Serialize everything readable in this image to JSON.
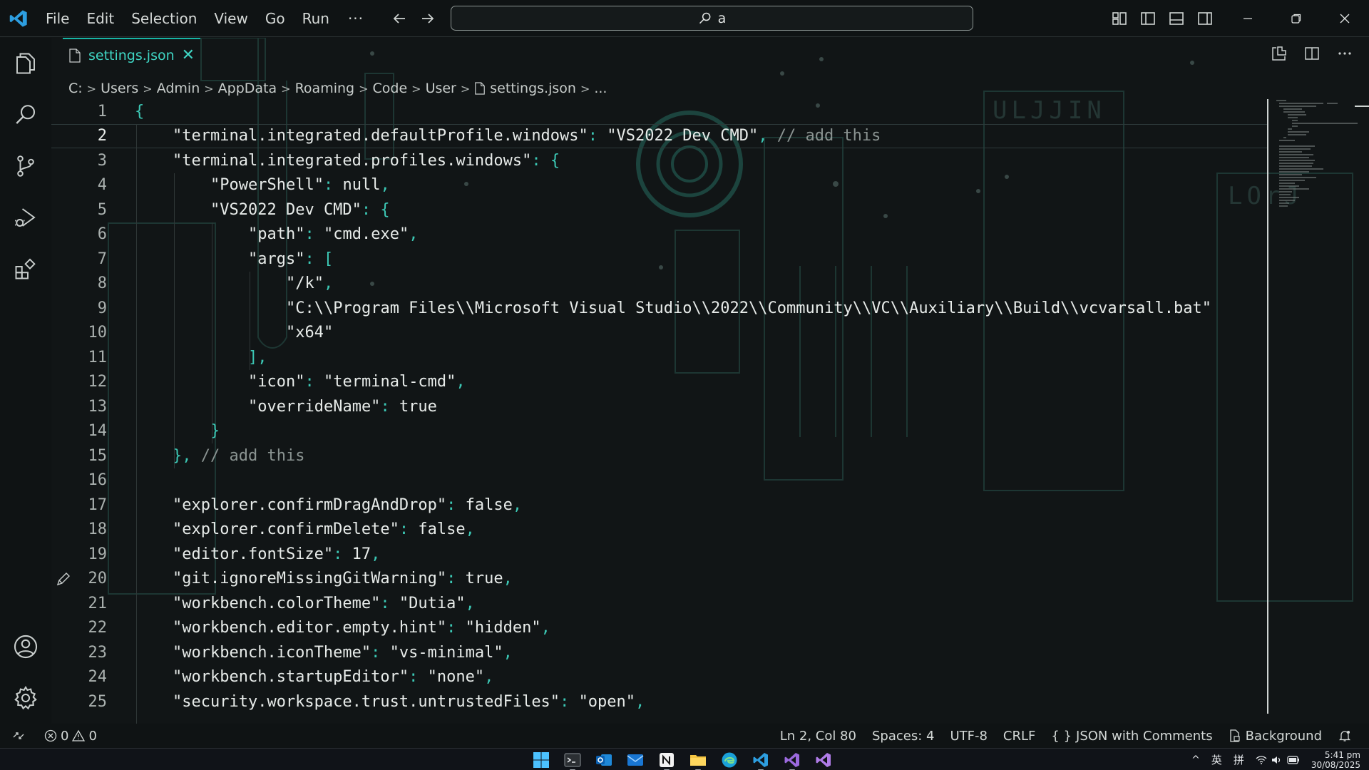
{
  "menu": {
    "items": [
      "File",
      "Edit",
      "Selection",
      "View",
      "Go",
      "Run"
    ],
    "more": "···"
  },
  "command_center": {
    "text": "a"
  },
  "colors": {
    "accent": "#18b6a5",
    "punct": "#3cc8b5",
    "comment": "#8a9391",
    "background": "#111516"
  },
  "tab": {
    "label": "settings.json",
    "close": "✕"
  },
  "breadcrumb": {
    "items": [
      "C:",
      "Users",
      "Admin",
      "AppData",
      "Roaming",
      "Code",
      "User",
      "settings.json",
      "..."
    ]
  },
  "editor": {
    "current_line": 2,
    "lines": [
      {
        "n": "1",
        "indent": 0,
        "tokens": [
          [
            "p",
            "{"
          ]
        ]
      },
      {
        "n": "2",
        "indent": 1,
        "tokens": [
          [
            "k",
            "\"terminal.integrated.defaultProfile.windows\""
          ],
          [
            "p",
            ": "
          ],
          [
            "k",
            "\"VS2022 Dev CMD\""
          ],
          [
            "p",
            ", "
          ],
          [
            "c",
            "// add this"
          ]
        ]
      },
      {
        "n": "3",
        "indent": 1,
        "tokens": [
          [
            "k",
            "\"terminal.integrated.profiles.windows\""
          ],
          [
            "p",
            ": {"
          ]
        ]
      },
      {
        "n": "4",
        "indent": 2,
        "tokens": [
          [
            "k",
            "\"PowerShell\""
          ],
          [
            "p",
            ": "
          ],
          [
            "k",
            "null"
          ],
          [
            "p",
            ","
          ]
        ]
      },
      {
        "n": "5",
        "indent": 2,
        "tokens": [
          [
            "k",
            "\"VS2022 Dev CMD\""
          ],
          [
            "p",
            ": {"
          ]
        ]
      },
      {
        "n": "6",
        "indent": 3,
        "tokens": [
          [
            "k",
            "\"path\""
          ],
          [
            "p",
            ": "
          ],
          [
            "k",
            "\"cmd.exe\""
          ],
          [
            "p",
            ","
          ]
        ]
      },
      {
        "n": "7",
        "indent": 3,
        "tokens": [
          [
            "k",
            "\"args\""
          ],
          [
            "p",
            ": ["
          ]
        ]
      },
      {
        "n": "8",
        "indent": 4,
        "tokens": [
          [
            "k",
            "\"/k\""
          ],
          [
            "p",
            ","
          ]
        ]
      },
      {
        "n": "9",
        "indent": 4,
        "tokens": [
          [
            "k",
            "\"C:\\\\Program Files\\\\Microsoft Visual Studio\\\\2022\\\\Community\\\\VC\\\\Auxiliary\\\\Build\\\\vcvarsall.bat\""
          ]
        ]
      },
      {
        "n": "10",
        "indent": 4,
        "tokens": [
          [
            "k",
            "\"x64\""
          ]
        ]
      },
      {
        "n": "11",
        "indent": 3,
        "tokens": [
          [
            "p",
            "],"
          ]
        ]
      },
      {
        "n": "12",
        "indent": 3,
        "tokens": [
          [
            "k",
            "\"icon\""
          ],
          [
            "p",
            ": "
          ],
          [
            "k",
            "\"terminal-cmd\""
          ],
          [
            "p",
            ","
          ]
        ]
      },
      {
        "n": "13",
        "indent": 3,
        "tokens": [
          [
            "k",
            "\"overrideName\""
          ],
          [
            "p",
            ": "
          ],
          [
            "k",
            "true"
          ]
        ]
      },
      {
        "n": "14",
        "indent": 2,
        "tokens": [
          [
            "p",
            "}"
          ]
        ]
      },
      {
        "n": "15",
        "indent": 1,
        "tokens": [
          [
            "p",
            "}, "
          ],
          [
            "c",
            "// add this"
          ]
        ]
      },
      {
        "n": "16",
        "indent": 0,
        "tokens": []
      },
      {
        "n": "17",
        "indent": 1,
        "tokens": [
          [
            "k",
            "\"explorer.confirmDragAndDrop\""
          ],
          [
            "p",
            ": "
          ],
          [
            "k",
            "false"
          ],
          [
            "p",
            ","
          ]
        ]
      },
      {
        "n": "18",
        "indent": 1,
        "tokens": [
          [
            "k",
            "\"explorer.confirmDelete\""
          ],
          [
            "p",
            ": "
          ],
          [
            "k",
            "false"
          ],
          [
            "p",
            ","
          ]
        ]
      },
      {
        "n": "19",
        "indent": 1,
        "tokens": [
          [
            "k",
            "\"editor.fontSize\""
          ],
          [
            "p",
            ": "
          ],
          [
            "k",
            "17"
          ],
          [
            "p",
            ","
          ]
        ]
      },
      {
        "n": "20",
        "indent": 1,
        "tokens": [
          [
            "k",
            "\"git.ignoreMissingGitWarning\""
          ],
          [
            "p",
            ": "
          ],
          [
            "k",
            "true"
          ],
          [
            "p",
            ","
          ]
        ]
      },
      {
        "n": "21",
        "indent": 1,
        "tokens": [
          [
            "k",
            "\"workbench.colorTheme\""
          ],
          [
            "p",
            ": "
          ],
          [
            "k",
            "\"Dutia\""
          ],
          [
            "p",
            ","
          ]
        ]
      },
      {
        "n": "22",
        "indent": 1,
        "tokens": [
          [
            "k",
            "\"workbench.editor.empty.hint\""
          ],
          [
            "p",
            ": "
          ],
          [
            "k",
            "\"hidden\""
          ],
          [
            "p",
            ","
          ]
        ]
      },
      {
        "n": "23",
        "indent": 1,
        "tokens": [
          [
            "k",
            "\"workbench.iconTheme\""
          ],
          [
            "p",
            ": "
          ],
          [
            "k",
            "\"vs-minimal\""
          ],
          [
            "p",
            ","
          ]
        ]
      },
      {
        "n": "24",
        "indent": 1,
        "tokens": [
          [
            "k",
            "\"workbench.startupEditor\""
          ],
          [
            "p",
            ": "
          ],
          [
            "k",
            "\"none\""
          ],
          [
            "p",
            ","
          ]
        ]
      },
      {
        "n": "25",
        "indent": 1,
        "tokens": [
          [
            "k",
            "\"security.workspace.trust.untrustedFiles\""
          ],
          [
            "p",
            ": "
          ],
          [
            "k",
            "\"open\""
          ],
          [
            "p",
            ","
          ]
        ]
      }
    ]
  },
  "statusbar": {
    "errors": "0",
    "warnings": "0",
    "position": "Ln 2, Col 80",
    "spaces": "Spaces: 4",
    "encoding": "UTF-8",
    "eol": "CRLF",
    "lang_braces": "{ }",
    "language": "JSON with Comments",
    "background": "Background"
  },
  "taskbar": {
    "tray_chevron": "^",
    "ime1": "英",
    "ime2": "拼",
    "time": "5:41 pm",
    "date": "30/08/2025"
  }
}
